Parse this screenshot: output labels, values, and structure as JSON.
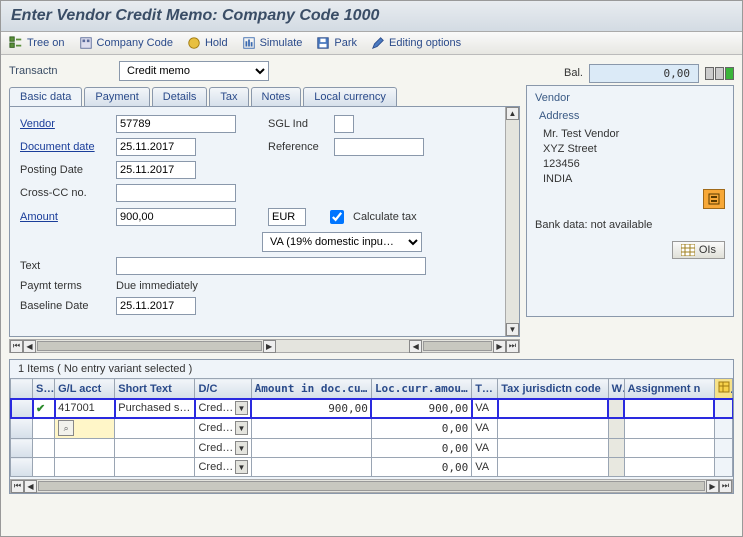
{
  "title": "Enter Vendor Credit Memo: Company Code 1000",
  "toolbar": {
    "tree": "Tree on",
    "company": "Company Code",
    "hold": "Hold",
    "simulate": "Simulate",
    "park": "Park",
    "editing": "Editing options"
  },
  "transactn_label": "Transactn",
  "transactn_value": "Credit memo",
  "bal_label": "Bal.",
  "bal_value": "0,00",
  "tabs": {
    "basic": "Basic data",
    "payment": "Payment",
    "details": "Details",
    "tax": "Tax",
    "notes": "Notes",
    "local": "Local currency"
  },
  "form": {
    "vendor_lbl": "Vendor",
    "vendor_val": "57789",
    "sgl_lbl": "SGL Ind",
    "sgl_val": "",
    "docdate_lbl": "Document date",
    "docdate_val": "25.11.2017",
    "ref_lbl": "Reference",
    "ref_val": "",
    "postdate_lbl": "Posting Date",
    "postdate_val": "25.11.2017",
    "crosscc_lbl": "Cross-CC no.",
    "crosscc_val": "",
    "amount_lbl": "Amount",
    "amount_val": "900,00",
    "curr_val": "EUR",
    "calctax_lbl": "Calculate tax",
    "taxcode_val": "VA (19% domestic inpu…",
    "text_lbl": "Text",
    "text_val": "",
    "paymt_lbl": "Paymt terms",
    "paymt_val": "Due immediately",
    "baseline_lbl": "Baseline Date",
    "baseline_val": "25.11.2017"
  },
  "vendorbox": {
    "title": "Vendor",
    "addr_title": "Address",
    "l1": "Mr. Test Vendor",
    "l2": "XYZ Street",
    "l3": "123456",
    "l4": "INDIA",
    "bank": "Bank data: not available",
    "ois": "OIs"
  },
  "grid": {
    "title": "1 Items ( No entry variant selected )",
    "cols": {
      "s": "S…",
      "gl": "G/L acct",
      "short": "Short Text",
      "dc": "D/C",
      "amtdoc": "Amount in doc.curr.",
      "amtloc": "Loc.curr.amount",
      "t": "T…",
      "jur": "Tax jurisdictn code",
      "w": "W",
      "asg": "Assignment n"
    },
    "rows": [
      {
        "check": true,
        "gl": "417001",
        "short": "Purchased s…",
        "dc": "Cred…",
        "amtdoc": "900,00",
        "amtloc": "900,00",
        "t": "VA"
      },
      {
        "check": false,
        "gl": "",
        "short": "",
        "dc": "Cred…",
        "amtdoc": "",
        "amtloc": "0,00",
        "t": "VA"
      },
      {
        "check": false,
        "gl": "",
        "short": "",
        "dc": "Cred…",
        "amtdoc": "",
        "amtloc": "0,00",
        "t": "VA"
      },
      {
        "check": false,
        "gl": "",
        "short": "",
        "dc": "Cred…",
        "amtdoc": "",
        "amtloc": "0,00",
        "t": "VA"
      }
    ]
  }
}
